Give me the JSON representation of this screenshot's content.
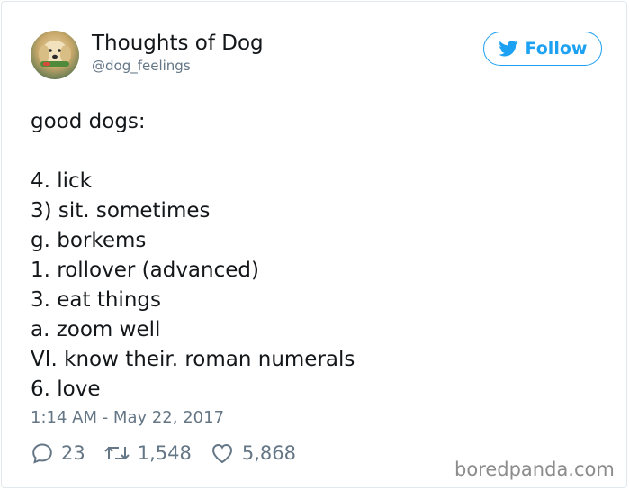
{
  "tweet": {
    "display_name": "Thoughts of Dog",
    "handle": "@dog_feelings",
    "follow_label": "Follow",
    "text_lines": [
      "good dogs:",
      "",
      "4. lick",
      "3) sit. sometimes",
      "g. borkems",
      "1. rollover (advanced)",
      "3. eat things",
      "a. zoom well",
      "VI. know their. roman numerals",
      "6. love"
    ],
    "timestamp": "1:14 AM - May 22, 2017",
    "stats": {
      "replies": "23",
      "retweets": "1,548",
      "likes": "5,868"
    }
  },
  "watermark": "boredpanda.com",
  "colors": {
    "accent": "#1da1f2",
    "muted": "#657786",
    "text": "#14171a",
    "border": "#e1e8ed"
  },
  "icons": {
    "follow": "twitter-bird-icon",
    "reply": "reply-icon",
    "retweet": "retweet-icon",
    "like": "heart-icon"
  }
}
